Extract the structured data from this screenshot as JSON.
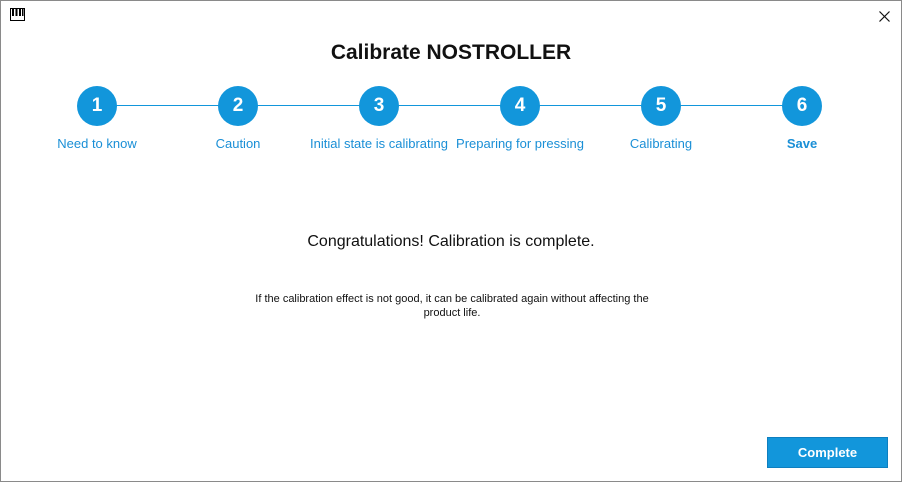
{
  "window": {
    "app_icon": "piano-keys-icon",
    "close_icon": "close-icon"
  },
  "dialog": {
    "title": "Calibrate NOSTROLLER",
    "steps": [
      {
        "number": "1",
        "label": "Need to know"
      },
      {
        "number": "2",
        "label": "Caution"
      },
      {
        "number": "3",
        "label": "Initial state is calibrating"
      },
      {
        "number": "4",
        "label": "Preparing for pressing"
      },
      {
        "number": "5",
        "label": "Calibrating"
      },
      {
        "number": "6",
        "label": "Save"
      }
    ],
    "active_step": 6,
    "message": "Congratulations! Calibration is complete.",
    "note": "If the calibration effect is not good, it can be calibrated again without affecting the product life.",
    "complete_label": "Complete"
  },
  "colors": {
    "accent": "#1296db",
    "label_blue": "#1a8fd6"
  }
}
